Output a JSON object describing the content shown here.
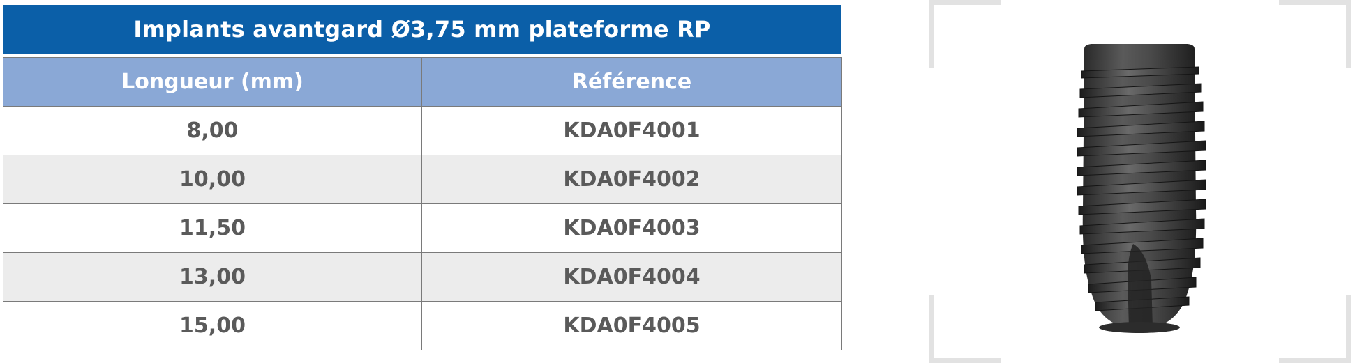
{
  "table": {
    "title": "Implants avantgard Ø3,75 mm plateforme RP",
    "headers": [
      "Longueur (mm)",
      "Référence"
    ],
    "rows": [
      {
        "length": "8,00",
        "reference": "KDA0F4001"
      },
      {
        "length": "10,00",
        "reference": "KDA0F4002"
      },
      {
        "length": "11,50",
        "reference": "KDA0F4003"
      },
      {
        "length": "13,00",
        "reference": "KDA0F4004"
      },
      {
        "length": "15,00",
        "reference": "KDA0F4005"
      }
    ]
  },
  "colors": {
    "title_bg": "#0b5fa8",
    "header_bg": "#8aa8d6",
    "row_alt_bg": "#ececec",
    "implant": "#3a3a3a"
  },
  "image": {
    "icon": "dental-implant-icon"
  }
}
